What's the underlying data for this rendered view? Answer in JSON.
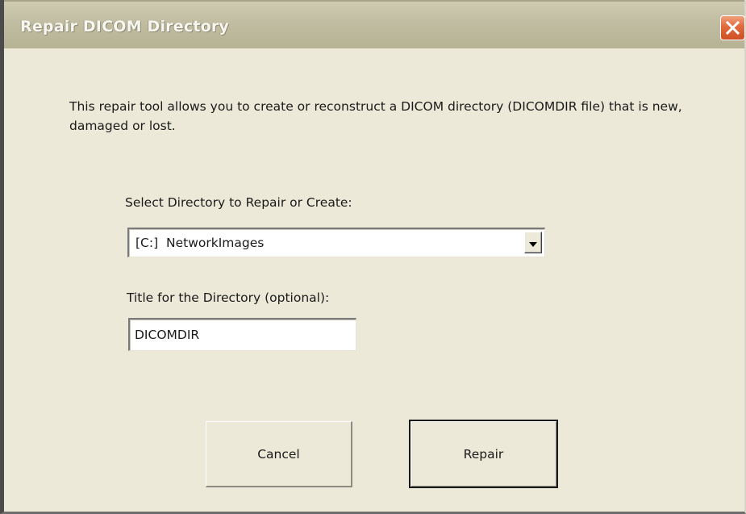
{
  "window": {
    "title": "Repair DICOM Directory",
    "close_icon": "close-x-icon"
  },
  "description": "This repair tool allows you to create or reconstruct a DICOM directory (DICOMDIR file) that is new, damaged or lost.",
  "directory_select": {
    "label": "Select Directory to Repair or Create:",
    "value": "[C:]  NetworkImages",
    "dropdown_icon": "chevron-down-icon"
  },
  "title_field": {
    "label": "Title for the Directory (optional):",
    "value": "DICOMDIR"
  },
  "buttons": {
    "cancel_label": "Cancel",
    "repair_label": "Repair"
  },
  "colors": {
    "dialog_background": "#ece9d8",
    "close_button": "#e06a3e"
  }
}
